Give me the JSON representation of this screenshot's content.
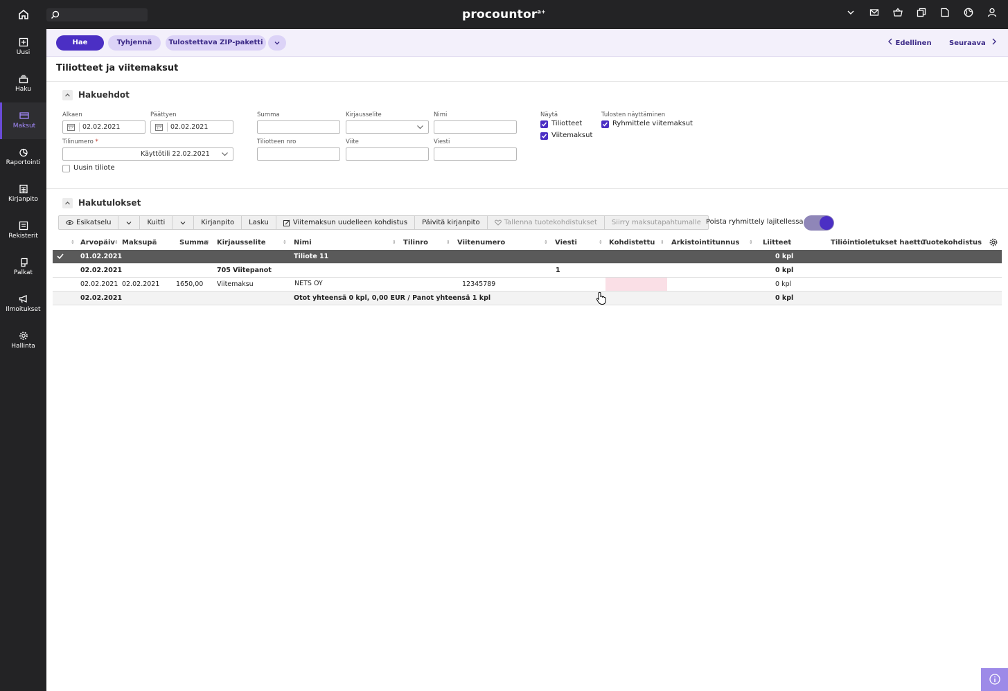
{
  "brand": {
    "name": "procountor",
    "mark": "a+"
  },
  "topbar_icons": [
    "chevron-down-icon",
    "mail-icon",
    "basket-icon",
    "copy-icon",
    "document-icon",
    "globe-icon",
    "user-icon"
  ],
  "sidebar": {
    "items": [
      {
        "label": "Uusi",
        "icon": "plus-square-icon"
      },
      {
        "label": "Haku",
        "icon": "stack-icon"
      },
      {
        "label": "Maksut",
        "icon": "card-icon",
        "active": true
      },
      {
        "label": "Raportointi",
        "icon": "pie-chart-icon"
      },
      {
        "label": "Kirjanpito",
        "icon": "calculator-icon"
      },
      {
        "label": "Rekisterit",
        "icon": "register-icon"
      },
      {
        "label": "Palkat",
        "icon": "wallet-icon"
      },
      {
        "label": "Ilmoitukset",
        "icon": "megaphone-icon"
      },
      {
        "label": "Hallinta",
        "icon": "gear-icon"
      }
    ]
  },
  "actions": {
    "search": "Hae",
    "clear": "Tyhjennä",
    "zip": "Tulostettava ZIP-paketti",
    "prev": "Edellinen",
    "next": "Seuraava"
  },
  "page_title": "Tiliotteet ja viitemaksut",
  "criteria": {
    "title": "Hakuehdot",
    "start_label": "Alkaen",
    "start_value": "02.02.2021",
    "end_label": "Päättyen",
    "end_value": "02.02.2021",
    "account_label": "Tilinumero",
    "account_required": "*",
    "account_value": "Käyttötili  22.02.2021",
    "newest_label": "Uusin tiliote",
    "sum_label": "Summa",
    "entry_label": "Kirjausselite",
    "name_label": "Nimi",
    "statement_no_label": "Tiliotteen nro",
    "ref_label": "Viite",
    "message_label": "Viesti",
    "show_label": "Näytä",
    "show_statements": "Tiliotteet",
    "show_refpayments": "Viitemaksut",
    "display_label": "Tulosten näyttäminen",
    "group_refpayments": "Ryhmittele viitemaksut"
  },
  "results": {
    "title": "Hakutulokset",
    "toolbar": {
      "preview": "Esikatselu",
      "receipt": "Kuitti",
      "bookkeeping": "Kirjanpito",
      "invoice": "Lasku",
      "reallocate": "Viitemaksun uudelleen kohdistus",
      "update_bookkeeping": "Päivitä kirjanpito",
      "save_allocations": "Tallenna tuotekohdistukset",
      "move": "Siirry maksutapahtumalle"
    },
    "toggle_label": "Poista ryhmittely lajitellessa",
    "columns": {
      "arvopaiva": "Arvopäiv",
      "maksupaiva": "Maksupä",
      "summa": "Summa",
      "kirjausselite": "Kirjausselite",
      "nimi": "Nimi",
      "tilinro": "Tilinro",
      "viitenumero": "Viitenumero",
      "viesti": "Viesti",
      "kohdistettu": "Kohdistettu",
      "arkistointitunnus": "Arkistointitunnus",
      "liitteet": "Liitteet",
      "haettu": "Tiliöintioletukset haettu",
      "tuotekohdistus": "Tuotekohdistus"
    },
    "rows": [
      {
        "date": "01.02.2021",
        "name": "Tiliote 11",
        "attachments": "0 kpl"
      },
      {
        "date": "02.02.2021",
        "entry": "705 Viitepanot",
        "message": "1",
        "attachments": "0 kpl"
      },
      {
        "date": "02.02.2021",
        "paydate": "02.02.2021",
        "sum": "1650,00",
        "entry": "Viitemaksu",
        "name": "NETS OY",
        "ref": "12345789",
        "attachments": "0 kpl"
      },
      {
        "date": "02.02.2021",
        "name": "Otot yhteensä 0 kpl, 0,00 EUR / Panot yhteensä 1 kpl",
        "attachments": "0 kpl"
      }
    ]
  },
  "colors": {
    "accent": "#4b2fc4",
    "dark": "#232325",
    "pill": "#dcd3f7"
  }
}
